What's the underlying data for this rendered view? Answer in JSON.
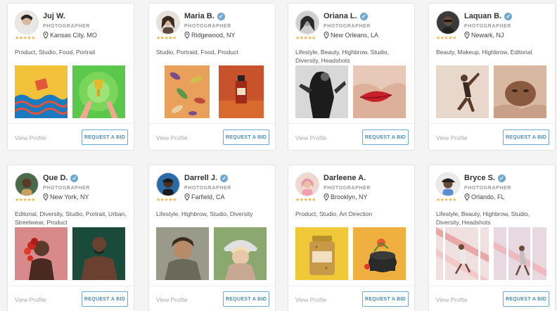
{
  "common": {
    "role": "PHOTOGRAPHER",
    "view_label": "View Profile",
    "bid_label": "REQUEST A BID",
    "stars": "★★★★★",
    "verified_glyph": "✓"
  },
  "cards": [
    {
      "name": "Juj W.",
      "location": "Kansas City, MO",
      "tags": "Product, Studio, Food, Portrait",
      "verified": false
    },
    {
      "name": "Maria B.",
      "location": "Ridgewood, NY",
      "tags": "Studio, Portraid, Food, Product",
      "verified": true
    },
    {
      "name": "Oriana L.",
      "location": "New Orleans, LA",
      "tags": "Lifestyle, Beauty, Highbrow, Studio, Diversity, Headshots",
      "verified": true
    },
    {
      "name": "Laquan B.",
      "location": "Newark, NJ",
      "tags": "Beauty, Makeup, Highbrow, Editorial",
      "verified": true
    },
    {
      "name": "Que D.",
      "location": "New York, NY",
      "tags": "Editorial, Diversity, Studio, Portrait, Urban, Streetwear, Product",
      "verified": true
    },
    {
      "name": "Darrell J.",
      "location": "Farfield, CA",
      "tags": "Lifestyle, Highbrow, Studio, Diversity",
      "verified": true
    },
    {
      "name": "Darleene A.",
      "location": "Brooklyn, NY",
      "tags": "Product, Studio, Art Direction",
      "verified": false
    },
    {
      "name": "Bryce S.",
      "location": "Orlando, FL",
      "tags": "Lifestyle, Beauty, Highbrow, Studio, Diversity, Headshots",
      "verified": true
    }
  ],
  "colors": {
    "accent": "#6fa9cf",
    "star": "#f0b34a"
  }
}
